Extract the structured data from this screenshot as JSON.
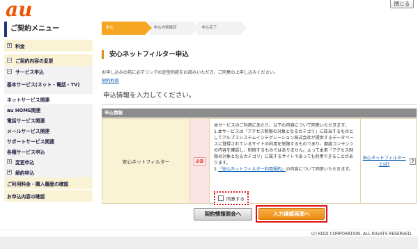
{
  "header": {
    "logo_text": "au",
    "brand_color": "#eb5505",
    "close_label": "閉じる"
  },
  "sidebar": {
    "title": "ご契約メニュー",
    "items": [
      {
        "label": "料金",
        "icon": "plus-square-icon"
      },
      {
        "label": "ご契約内容の変更",
        "icon": "minus-square-icon"
      },
      {
        "label": "サービス申込",
        "icon": "minus-square-icon"
      },
      {
        "label": "基本サービス(ネット・電話・TV)"
      },
      {
        "label": "ネットサービス関連"
      },
      {
        "label": "au HOME関連"
      },
      {
        "label": "電話サービス関連"
      },
      {
        "label": "メールサービス関連"
      },
      {
        "label": "サポートサービス関連"
      },
      {
        "label": "各種サービス申込"
      },
      {
        "label": "変更申込",
        "icon": "plus-square-icon"
      },
      {
        "label": "解約申込",
        "icon": "plus-square-icon"
      },
      {
        "label": "ご利用料金・購入履歴の確認"
      },
      {
        "label": "お申込内容の確認"
      }
    ]
  },
  "steps": [
    "申込",
    "申込内容確認",
    "申込完了"
  ],
  "main": {
    "title": "安心ネットフィルター申込",
    "intro": "お申し込みの前に必ずリンクの定型約款をお読みいただき、ご同意の上申し込みください。",
    "terms_link": "契約約款",
    "sub_heading": "申込情報を入力してください。",
    "section_label": "申込情報"
  },
  "form": {
    "row_label": "安心ネットフィルター",
    "required_badge": "必須",
    "body_intro": "本サービスのご利用にあたり、以下の内容について同意いただきます。",
    "item1": "1.本サービスは「アクセス制限の対象となるカテゴリ」に該当するものとしてアルプスシステムインテグレーション株式会社が提供するデータベースに登録されているサイトの利用を制限するものであり、都度コンテンツの内容を確認し、制限するものではありません。よって本来「アクセス制限の対象となるカテゴリ」に属するサイトであっても利用できることがあります。",
    "item2_prefix": "2.",
    "item2_link": "「安心ネットフィルター利用規約」",
    "item2_suffix": "の内容について同意いただきます。",
    "agree_label": "同意する",
    "help_link": "安心ネットフィルターとは?",
    "help_icon": "?"
  },
  "buttons": {
    "back": "契約情報照会へ",
    "next": "入力確認画面へ"
  },
  "footer": {
    "copyright": "(c) KDDI CORPORATION. ALL RIGHTS RESERVED."
  }
}
